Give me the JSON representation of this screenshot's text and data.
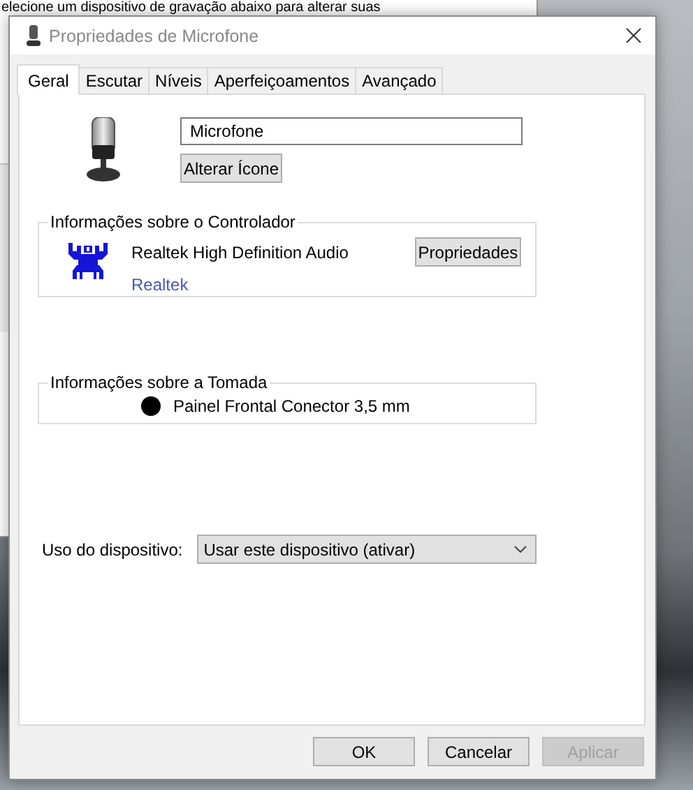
{
  "background_window": {
    "text": "elecione um dispositivo de gravação abaixo para alterar suas"
  },
  "window": {
    "title": "Propriedades de Microfone"
  },
  "tabs": [
    {
      "label": "Geral",
      "selected": true
    },
    {
      "label": "Escutar",
      "selected": false
    },
    {
      "label": "Níveis",
      "selected": false
    },
    {
      "label": "Aperfeiçoamentos",
      "selected": false
    },
    {
      "label": "Avançado",
      "selected": false
    }
  ],
  "device": {
    "name": "Microfone",
    "change_icon_button": "Alterar Ícone"
  },
  "controller": {
    "title": "Informações sobre o Controlador",
    "name": "Realtek High Definition Audio",
    "vendor_link": "Realtek",
    "button": "Propriedades"
  },
  "jack": {
    "title": "Informações sobre a Tomada",
    "label": "Painel Frontal Conector 3,5 mm"
  },
  "usage": {
    "label": "Uso do dispositivo:",
    "value": "Usar este dispositivo (ativar)"
  },
  "buttons": [
    {
      "label": "OK",
      "disabled": false
    },
    {
      "label": "Cancelar",
      "disabled": false
    },
    {
      "label": "Aplicar",
      "disabled": true
    }
  ]
}
